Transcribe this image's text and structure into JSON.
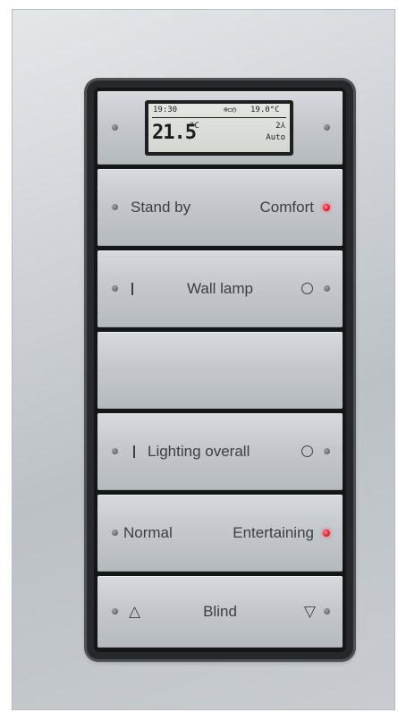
{
  "display": {
    "time": "19:30",
    "status_icons": "⊕◻◷",
    "setpoint": "19.0°C",
    "temperature": "21.5",
    "temperature_unit": "°C",
    "fan_level": "2⅄",
    "mode": "Auto"
  },
  "buttons": [
    {
      "left": "Stand by",
      "right": "Comfort",
      "active_led": "right"
    },
    {
      "left_symbol": "I",
      "center": "Wall lamp",
      "right_symbol": "O"
    },
    {
      "empty": true
    },
    {
      "left_symbol": "I",
      "center": "Lighting overall",
      "right_symbol": "O"
    },
    {
      "left": "Normal",
      "right": "Entertaining",
      "active_led": "right"
    },
    {
      "left_symbol": "△",
      "center": "Blind",
      "right_symbol": "▽"
    }
  ],
  "colors": {
    "led_active": "#f2283a",
    "led_idle": "#6a7076",
    "text": "#3b3f44"
  },
  "icons": [
    "led-indicator",
    "on-symbol",
    "off-symbol",
    "up-arrow-icon",
    "down-arrow-icon"
  ]
}
